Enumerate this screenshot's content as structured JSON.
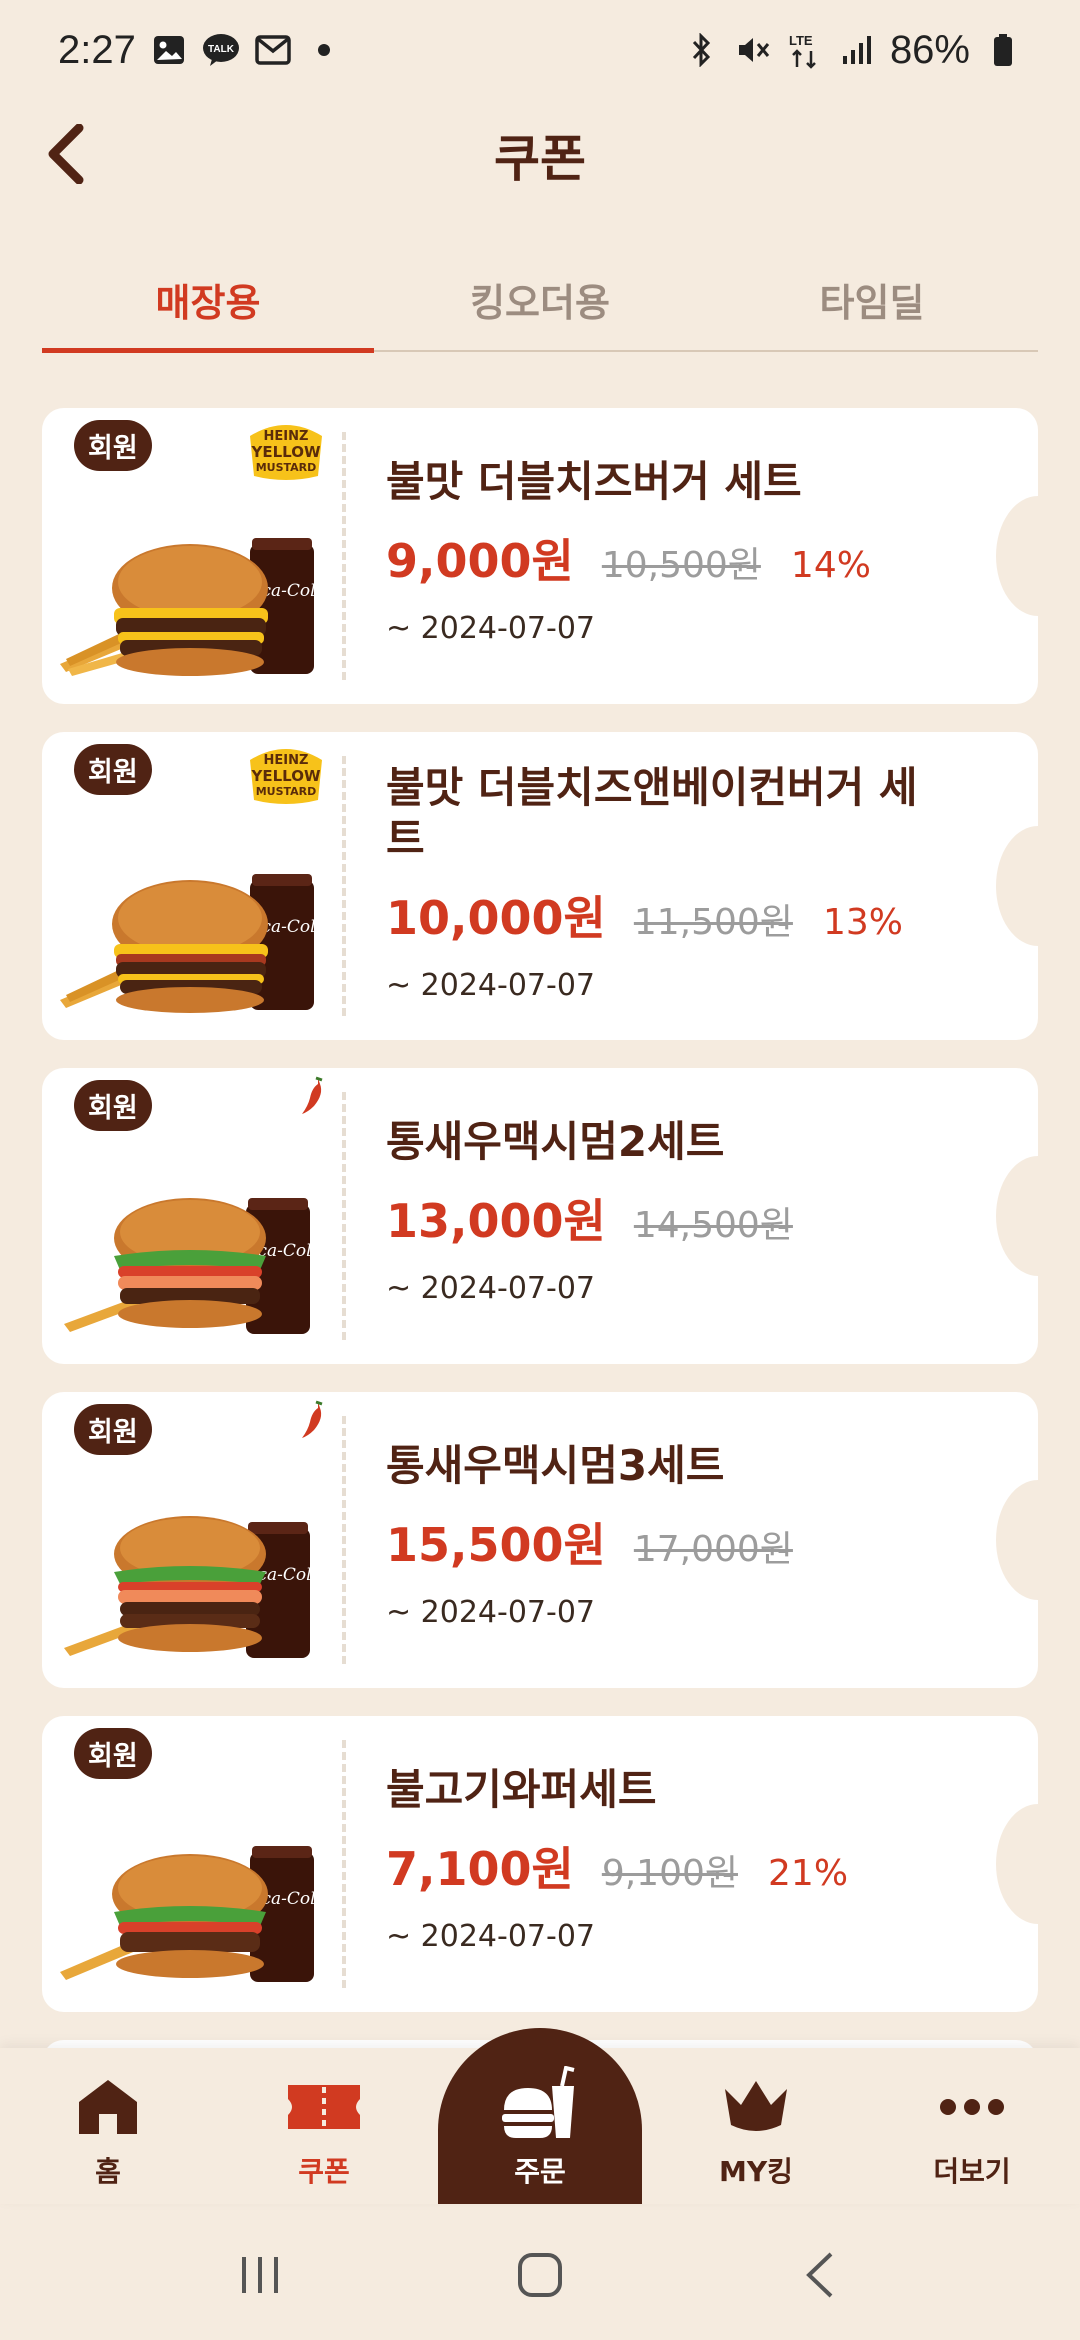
{
  "status_bar": {
    "time": "2:27",
    "battery": "86%",
    "network": "LTE"
  },
  "header": {
    "title": "쿠폰"
  },
  "tabs": [
    {
      "label": "매장용",
      "active": true
    },
    {
      "label": "킹오더용",
      "active": false
    },
    {
      "label": "타임딜",
      "active": false
    }
  ],
  "coupons": [
    {
      "badge": "회원",
      "name": "불맛 더블치즈버거 세트",
      "price": "9,000원",
      "original_price": "10,500원",
      "discount": "14%",
      "expiry": "~ 2024-07-07",
      "tag_icon": "mustard-icon"
    },
    {
      "badge": "회원",
      "name": "불맛 더블치즈앤베이컨버거 세트",
      "price": "10,000원",
      "original_price": "11,500원",
      "discount": "13%",
      "expiry": "~ 2024-07-07",
      "tag_icon": "mustard-icon"
    },
    {
      "badge": "회원",
      "name": "통새우맥시멈2세트",
      "price": "13,000원",
      "original_price": "14,500원",
      "discount": "",
      "expiry": "~ 2024-07-07",
      "tag_icon": "chili-icon"
    },
    {
      "badge": "회원",
      "name": "통새우맥시멈3세트",
      "price": "15,500원",
      "original_price": "17,000원",
      "discount": "",
      "expiry": "~ 2024-07-07",
      "tag_icon": "chili-icon"
    },
    {
      "badge": "회원",
      "name": "불고기와퍼세트",
      "price": "7,100원",
      "original_price": "9,100원",
      "discount": "21%",
      "expiry": "~ 2024-07-07",
      "tag_icon": ""
    }
  ],
  "logo_text": {
    "mustard_line1": "HEINZ",
    "mustard_line2": "YELLOW",
    "mustard_line3": "MUSTARD",
    "cola": "Coca-Cola"
  },
  "bottom_nav": {
    "home": "홈",
    "coupon": "쿠폰",
    "order": "주문",
    "my_king": "MY킹",
    "more": "더보기"
  },
  "colors": {
    "background": "#f5ebdf",
    "brown": "#502314",
    "red": "#d13a21"
  }
}
